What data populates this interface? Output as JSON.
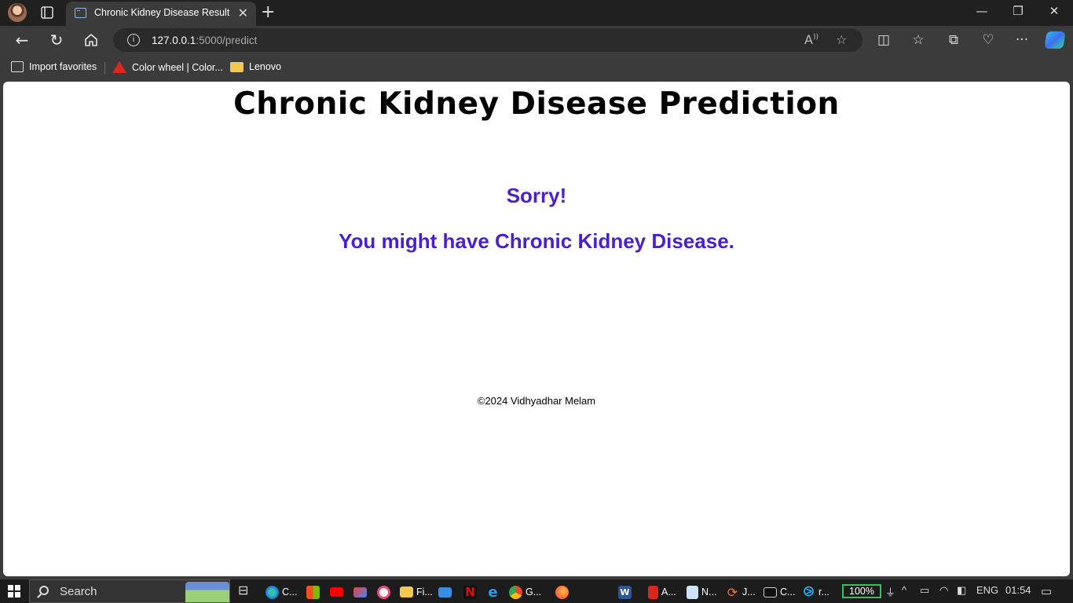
{
  "browser": {
    "tab_title": "Chronic Kidney Disease Result",
    "url_host": "127.0.0.1",
    "url_path": ":5000/predict",
    "favorites": [
      {
        "label": "Import favorites",
        "icon": "import-icon"
      },
      {
        "label": "Color wheel | Color...",
        "icon": "adobe-icon"
      },
      {
        "label": "Lenovo",
        "icon": "folder-icon"
      }
    ]
  },
  "page": {
    "title": "Chronic Kidney Disease Prediction",
    "result_line1": "Sorry!",
    "result_line2": "You might have Chronic Kidney Disease.",
    "footer": "©2024 Vidhyadhar Melam",
    "accent_color": "#4a1fd2"
  },
  "taskbar": {
    "search_placeholder": "Search",
    "apps": [
      {
        "label": "C...",
        "icon": "edge-icon"
      },
      {
        "label": "",
        "icon": "store-icon"
      },
      {
        "label": "",
        "icon": "youtube-icon"
      },
      {
        "label": "",
        "icon": "gmail-icon"
      },
      {
        "label": "",
        "icon": "instagram-icon"
      },
      {
        "label": "Fi...",
        "icon": "file-explorer-icon"
      },
      {
        "label": "",
        "icon": "remote-desktop-icon"
      },
      {
        "label": "",
        "icon": "netflix-icon"
      },
      {
        "label": "",
        "icon": "internet-explorer-icon"
      },
      {
        "label": "G...",
        "icon": "chrome-icon"
      },
      {
        "label": "",
        "icon": "firefox-icon"
      },
      {
        "label": "",
        "icon": "word-icon"
      },
      {
        "label": "A...",
        "icon": "acrobat-icon"
      },
      {
        "label": "N...",
        "icon": "notepad-icon"
      },
      {
        "label": "J...",
        "icon": "jupyter-icon"
      },
      {
        "label": "C...",
        "icon": "cmd-icon"
      },
      {
        "label": "r...",
        "icon": "vscode-icon"
      }
    ],
    "battery": "100%",
    "language": "ENG",
    "time": "01:54"
  }
}
